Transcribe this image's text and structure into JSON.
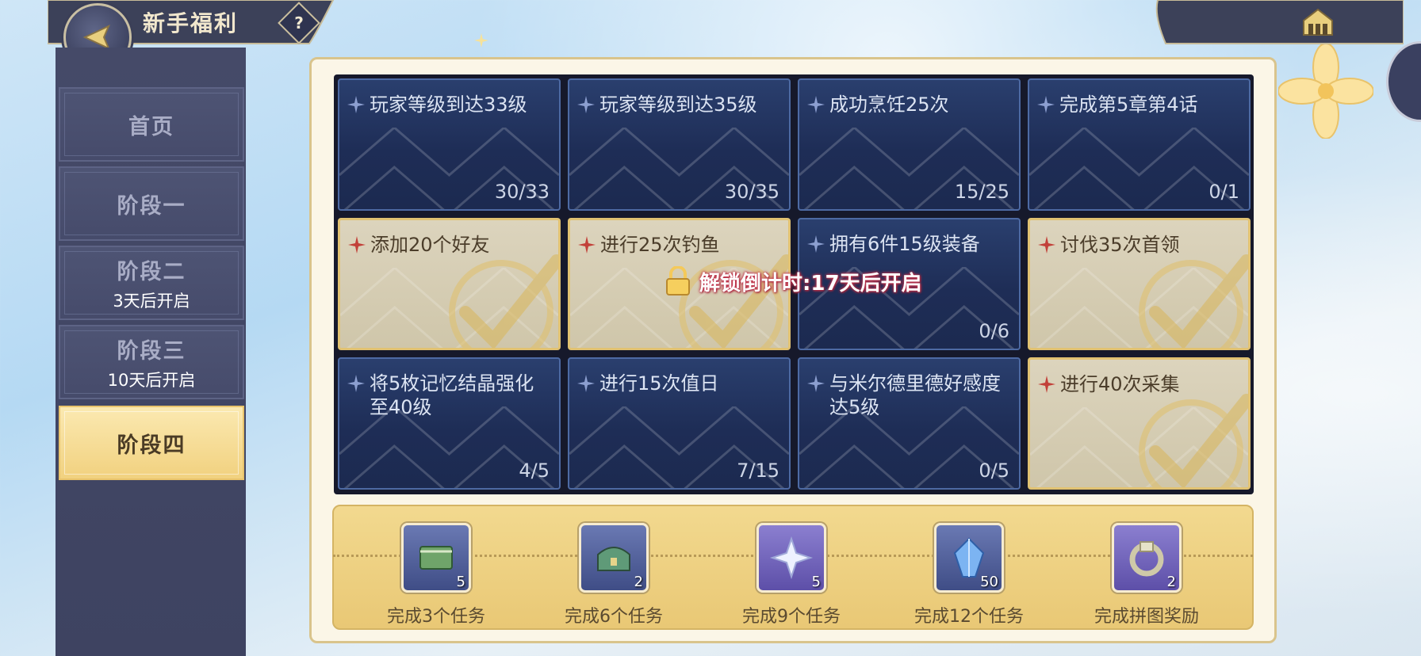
{
  "header": {
    "title": "新手福利",
    "help_label": "?"
  },
  "sidebar": {
    "items": [
      {
        "label": "首页",
        "sub": ""
      },
      {
        "label": "阶段一",
        "sub": ""
      },
      {
        "label": "阶段二",
        "sub": "3天后开启"
      },
      {
        "label": "阶段三",
        "sub": "10天后开启"
      },
      {
        "label": "阶段四",
        "sub": ""
      }
    ]
  },
  "tasks": [
    {
      "title": "玩家等级到达33级",
      "progress": "30/33",
      "state": "active"
    },
    {
      "title": "玩家等级到达35级",
      "progress": "30/35",
      "state": "active"
    },
    {
      "title": "成功烹饪25次",
      "progress": "15/25",
      "state": "active"
    },
    {
      "title": "完成第5章第4话",
      "progress": "0/1",
      "state": "active"
    },
    {
      "title": "添加20个好友",
      "progress": "",
      "state": "done"
    },
    {
      "title": "进行25次钓鱼",
      "progress": "",
      "state": "done"
    },
    {
      "title": "拥有6件15级装备",
      "progress": "0/6",
      "state": "active"
    },
    {
      "title": "讨伐35次首领",
      "progress": "",
      "state": "done"
    },
    {
      "title": "将5枚记忆结晶强化至40级",
      "progress": "4/5",
      "state": "active"
    },
    {
      "title": "进行15次值日",
      "progress": "7/15",
      "state": "active"
    },
    {
      "title": "与米尔德里德好感度达5级",
      "progress": "0/5",
      "state": "active"
    },
    {
      "title": "进行40次采集",
      "progress": "",
      "state": "done"
    }
  ],
  "lock": {
    "text": "解锁倒计时:17天后开启"
  },
  "rewards": [
    {
      "label": "完成3个任务",
      "count": "5",
      "icon": "green-book-icon"
    },
    {
      "label": "完成6个任务",
      "count": "2",
      "icon": "treasure-chest-icon"
    },
    {
      "label": "完成9个任务",
      "count": "5",
      "icon": "crystal-shard-icon"
    },
    {
      "label": "完成12个任务",
      "count": "50",
      "icon": "blue-gem-icon"
    },
    {
      "label": "完成拼图奖励",
      "count": "2",
      "icon": "ring-icon"
    }
  ],
  "colors": {
    "accent": "#f1d17f",
    "navy": "#1e2d56",
    "panel": "#fbf6e7",
    "lock_glow": "#c2304a"
  }
}
